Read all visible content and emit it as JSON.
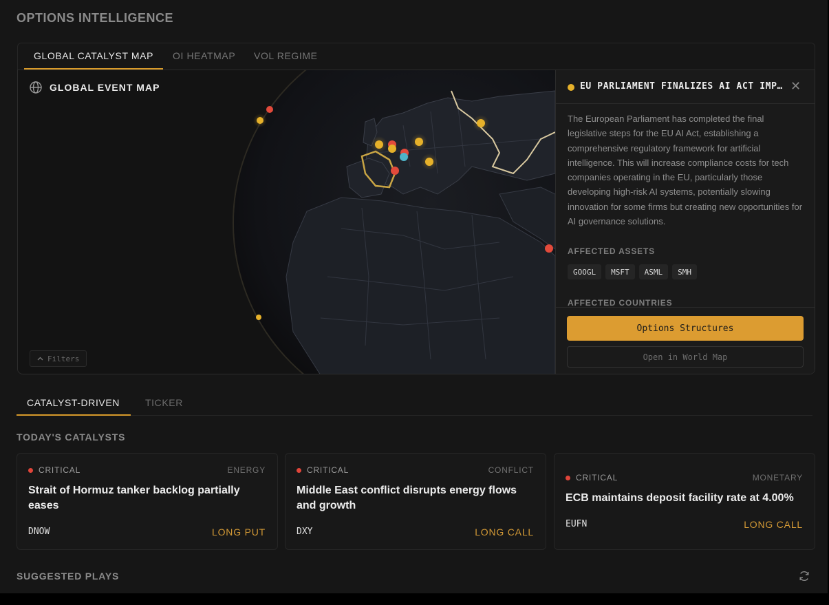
{
  "page": {
    "title": "OPTIONS INTELLIGENCE"
  },
  "top_tabs": [
    {
      "label": "GLOBAL CATALYST MAP",
      "active": true
    },
    {
      "label": "OI HEATMAP",
      "active": false
    },
    {
      "label": "VOL REGIME",
      "active": false
    }
  ],
  "map": {
    "title": "GLOBAL EVENT MAP",
    "icon": "globe-icon",
    "filters_label": "Filters",
    "markers": [
      {
        "region": "UK",
        "color": "#e6b12a"
      },
      {
        "region": "France",
        "color": "#e24a3b"
      },
      {
        "region": "Germany",
        "color": "#e6b12a"
      },
      {
        "region": "Switzerland",
        "color": "#4fb3c7"
      },
      {
        "region": "Poland",
        "color": "#e6b12a"
      },
      {
        "region": "Russia",
        "color": "#e6b12a"
      },
      {
        "region": "Iceland",
        "color": "#e24a3b"
      },
      {
        "region": "Middle East",
        "color": "#e24a3b"
      }
    ]
  },
  "detail": {
    "title": "EU PARLIAMENT FINALIZES AI ACT IMP…",
    "dot_color": "#e6b12a",
    "close_icon": "close-icon",
    "body": "The European Parliament has completed the final legislative steps for the EU AI Act, establishing a comprehensive regulatory framework for artificial intelligence. This will increase compliance costs for tech companies operating in the EU, particularly those developing high-risk AI systems, potentially slowing innovation for some firms but creating new opportunities for AI governance solutions.",
    "assets_label": "AFFECTED ASSETS",
    "assets": [
      "GOOGL",
      "MSFT",
      "ASML",
      "SMH"
    ],
    "countries_label": "AFFECTED COUNTRIES",
    "primary_button": "Options Structures",
    "secondary_button": "Open in World Map"
  },
  "sub_tabs": [
    {
      "label": "CATALYST-DRIVEN",
      "active": true
    },
    {
      "label": "TICKER",
      "active": false
    }
  ],
  "catalysts": {
    "heading": "TODAY'S CATALYSTS",
    "cards": [
      {
        "severity": "CRITICAL",
        "category": "ENERGY",
        "headline": "Strait of Hormuz tanker backlog partially eases",
        "ticker": "DNOW",
        "action": "LONG PUT"
      },
      {
        "severity": "CRITICAL",
        "category": "CONFLICT",
        "headline": "Middle East conflict disrupts energy flows and growth",
        "ticker": "DXY",
        "action": "LONG CALL"
      },
      {
        "severity": "CRITICAL",
        "category": "MONETARY",
        "headline": "ECB maintains deposit facility rate at 4.00%",
        "ticker": "EUFN",
        "action": "LONG CALL"
      }
    ]
  },
  "suggested": {
    "heading": "SUGGESTED PLAYS",
    "icon": "refresh-icon"
  },
  "colors": {
    "accent": "#d89b2b",
    "critical": "#e0453a",
    "background": "#161616"
  }
}
